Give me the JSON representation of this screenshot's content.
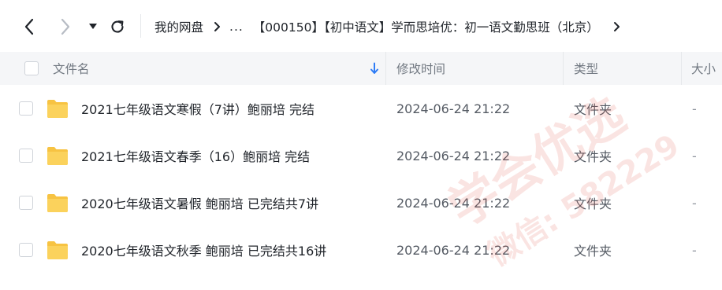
{
  "toolbar": {
    "back_icon": "chevron-left-icon",
    "forward_icon": "chevron-right-icon",
    "dropdown_icon": "caret-down-icon",
    "refresh_icon": "refresh-icon"
  },
  "breadcrumb": {
    "items": [
      "我的网盘",
      "...",
      "【000150】【初中语文】学而思培优：初一语文勤思班（北京）"
    ],
    "separator_icon": "chevron-right-icon",
    "more_icon": "chevron-right-icon"
  },
  "table": {
    "columns": {
      "name": "文件名",
      "modified": "修改时间",
      "type": "类型",
      "size": "大小"
    },
    "sort_icon": "arrow-down-icon",
    "rows": [
      {
        "name": "2021七年级语文寒假（7讲）鲍丽培 完结",
        "modified": "2024-06-24 21:22",
        "type": "文件夹",
        "size": "-"
      },
      {
        "name": "2021七年级语文春季（16）鲍丽培 完结",
        "modified": "2024-06-24 21:22",
        "type": "文件夹",
        "size": "-"
      },
      {
        "name": "2020七年级语文暑假 鲍丽培 已完结共7讲",
        "modified": "2024-06-24 21:22",
        "type": "文件夹",
        "size": "-"
      },
      {
        "name": "2020七年级语文秋季 鲍丽培 已完结共16讲",
        "modified": "2024-06-24 21:22",
        "type": "文件夹",
        "size": "-"
      }
    ]
  },
  "watermark": {
    "line1": "学会优选",
    "line2": "微信: 582229"
  },
  "colors": {
    "folder": "#f7c342",
    "accent": "#2e7cf6",
    "header_bg": "#f5f6f8",
    "watermark": "#e2554a"
  }
}
